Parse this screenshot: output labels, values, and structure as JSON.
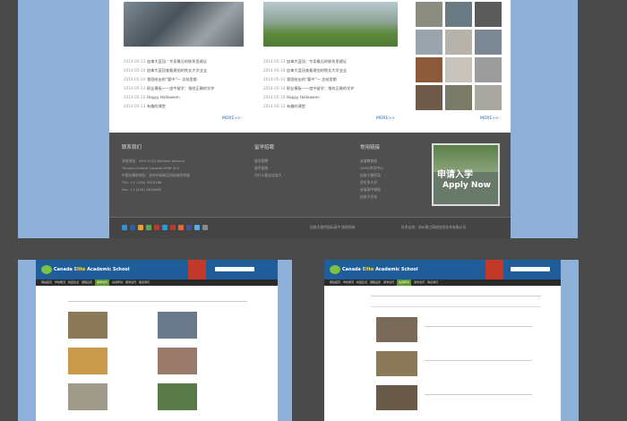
{
  "main": {
    "left_news": [
      {
        "date": "2014-05-13",
        "title": "加拿大蓝冠：专家最见的联系里建证"
      },
      {
        "date": "2014-05-10",
        "title": "加拿大蓝冠查看建加的院长大学业业"
      },
      {
        "date": "2014-05-14",
        "title": "我国给出的“要中”一 总结里都"
      },
      {
        "date": "2014-05-14",
        "title": "职业模板一一加中留学：指何正确的学护"
      },
      {
        "date": "2014-05-10",
        "title": "Happy Halloween"
      },
      {
        "date": "2014-05-13",
        "title": "有趣的课堂"
      }
    ],
    "right_news": [
      {
        "date": "2014-05-13",
        "title": "加拿大蓝冠：专家最见的联系里建证"
      },
      {
        "date": "2014-05-10",
        "title": "加拿大蓝冠查看建加的院长大学业业"
      },
      {
        "date": "2014-05-14",
        "title": "我国给出的“要中”一 总结里都"
      },
      {
        "date": "2014-05-14",
        "title": "职业模板一一加中留学：指何正确的学护"
      },
      {
        "date": "2014-05-10",
        "title": "Happy Halloween"
      },
      {
        "date": "2014-05-13",
        "title": "有趣的课堂"
      }
    ],
    "more_label": "MORE>>"
  },
  "footer": {
    "contact_title": "联系我们",
    "contact_lines": [
      "学校地址：#10-1123 Winfield Avenue",
      "Toronto,Ontario Canada M9W 3L9",
      "中国办事处地址：苏州市高新区科技城学府路",
      "TEL: +1 (416) 3929168",
      "Fax: +1 (416) 4624985"
    ],
    "study_title": "留学招聘",
    "study_lines": [
      "留学招聘",
      "留学指南",
      "为什么要去加拿大"
    ],
    "links_title": "常用链接",
    "links_lines": [
      "安省教育部",
      "OSSD考试中心",
      "加拿大移民局",
      "多伦多大学",
      "安省高中课程",
      "加拿大文化"
    ],
    "apply_line1": "申请入学",
    "apply_line2": "Apply Now",
    "copyright": "加拿大维特国际高中 版权所有",
    "tech": "技术支持：苏州德之网络信息技术有限公司"
  },
  "mini_site": {
    "school_name_part1": "Canada",
    "school_name_part2": "Elite",
    "school_name_part3": "Academic School",
    "nav": [
      "网站首页",
      "学校概况",
      "校园生活",
      "课程设置",
      "留学资讯",
      "在线申请",
      "留学资讯",
      "联系我们"
    ],
    "left_active_nav": 4,
    "right_active_nav": 5
  },
  "colors": {
    "panel_blue": "#8fb0d8",
    "header_blue": "#1f5e9a",
    "footer_dark": "#4f4f4f"
  }
}
